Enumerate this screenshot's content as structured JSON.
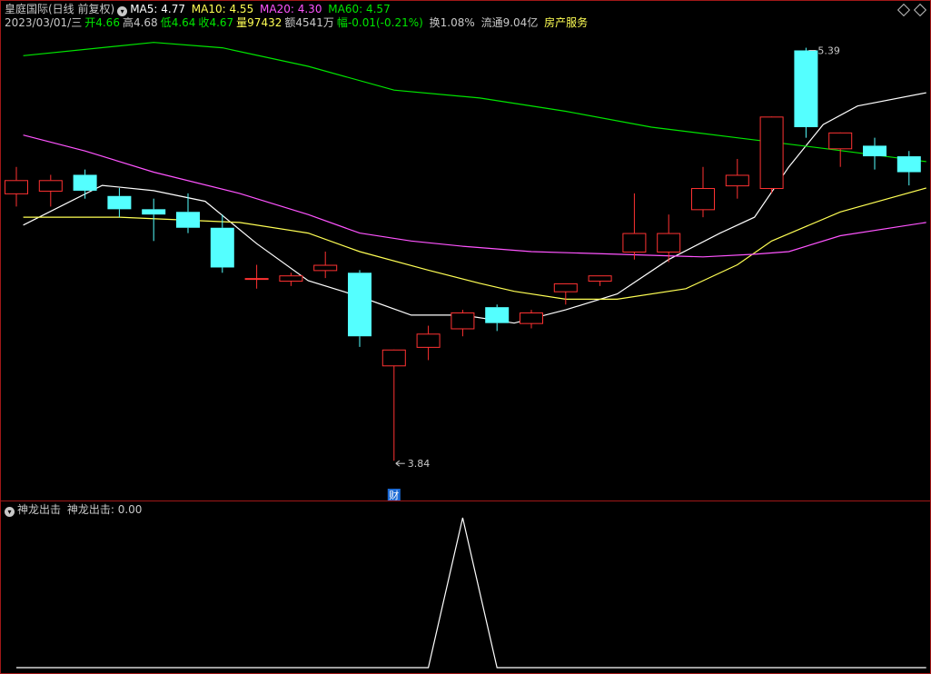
{
  "header": {
    "stock_title": "皇庭国际(日线 前复权)",
    "ma5_label": "MA5: 4.77",
    "ma10_label": "MA10: 4.55",
    "ma20_label": "MA20: 4.30",
    "ma60_label": "MA60: 4.57",
    "date": "2023/03/01/三",
    "open_label": "开",
    "open_value": "4.66",
    "high_label": "高",
    "high_value": "4.68",
    "low_label": "低",
    "low_value": "4.64",
    "close_label": "收",
    "close_value": "4.67",
    "volume_label": "量",
    "volume_value": "97432",
    "amount_label": "额",
    "amount_value": "4541万",
    "change_label": "幅",
    "change_value": "-0.01(-0.21%)",
    "turnover": "换1.08%",
    "float_cap": "流通9.04亿",
    "sector": "房产服务"
  },
  "indicator": {
    "name": "神龙出击",
    "value_label": "神龙出击: 0.00"
  },
  "colors": {
    "up": "#ff3232",
    "down": "#54ffff",
    "ma5": "#ffffff",
    "ma10": "#ffff54",
    "ma20": "#ff54ff",
    "ma60": "#00e600",
    "panel_border": "#a01818",
    "axis_text": "#c8c8c8"
  },
  "chart_data": [
    {
      "type": "candlestick",
      "y_range": [
        3.7,
        5.45
      ],
      "candles": [
        {
          "open": 4.85,
          "high": 4.95,
          "low": 4.8,
          "close": 4.9
        },
        {
          "open": 4.86,
          "high": 4.92,
          "low": 4.8,
          "close": 4.9
        },
        {
          "open": 4.92,
          "high": 4.94,
          "low": 4.83,
          "close": 4.86
        },
        {
          "open": 4.84,
          "high": 4.87,
          "low": 4.76,
          "close": 4.79
        },
        {
          "open": 4.79,
          "high": 4.83,
          "low": 4.67,
          "close": 4.77
        },
        {
          "open": 4.78,
          "high": 4.85,
          "low": 4.7,
          "close": 4.72
        },
        {
          "open": 4.72,
          "high": 4.77,
          "low": 4.55,
          "close": 4.57
        },
        {
          "open": 4.53,
          "high": 4.58,
          "low": 4.49,
          "close": 4.53
        },
        {
          "open": 4.52,
          "high": 4.55,
          "low": 4.5,
          "close": 4.54
        },
        {
          "open": 4.56,
          "high": 4.63,
          "low": 4.53,
          "close": 4.58
        },
        {
          "open": 4.55,
          "high": 4.56,
          "low": 4.27,
          "close": 4.31
        },
        {
          "open": 4.2,
          "high": 4.25,
          "low": 3.84,
          "close": 4.26
        },
        {
          "open": 4.27,
          "high": 4.35,
          "low": 4.22,
          "close": 4.32
        },
        {
          "open": 4.34,
          "high": 4.41,
          "low": 4.31,
          "close": 4.4
        },
        {
          "open": 4.42,
          "high": 4.43,
          "low": 4.33,
          "close": 4.36
        },
        {
          "open": 4.36,
          "high": 4.41,
          "low": 4.34,
          "close": 4.4
        },
        {
          "open": 4.48,
          "high": 4.51,
          "low": 4.43,
          "close": 4.51
        },
        {
          "open": 4.52,
          "high": 4.54,
          "low": 4.5,
          "close": 4.54
        },
        {
          "open": 4.63,
          "high": 4.85,
          "low": 4.6,
          "close": 4.7
        },
        {
          "open": 4.63,
          "high": 4.77,
          "low": 4.59,
          "close": 4.7
        },
        {
          "open": 4.79,
          "high": 4.95,
          "low": 4.76,
          "close": 4.87
        },
        {
          "open": 4.88,
          "high": 4.98,
          "low": 4.83,
          "close": 4.92
        },
        {
          "open": 4.87,
          "high": 5.03,
          "low": 4.85,
          "close": 5.14
        },
        {
          "open": 5.39,
          "high": 5.4,
          "low": 5.06,
          "close": 5.1
        },
        {
          "open": 5.02,
          "high": 5.05,
          "low": 4.95,
          "close": 5.08
        },
        {
          "open": 5.03,
          "high": 5.06,
          "low": 4.94,
          "close": 4.99
        },
        {
          "open": 4.99,
          "high": 5.01,
          "low": 4.88,
          "close": 4.93
        }
      ],
      "annotations": [
        {
          "text": "5.39",
          "candle": 23,
          "price": 5.39
        },
        {
          "text": "3.84",
          "candle": 11,
          "price": 3.84
        },
        {
          "text": "财",
          "candle": 11,
          "price": 3.81
        }
      ],
      "series": [
        {
          "name": "MA5",
          "color": "#ffffff",
          "points": [
            [
              0.2,
              4.73
            ],
            [
              2.5,
              4.88
            ],
            [
              4.0,
              4.86
            ],
            [
              5.5,
              4.82
            ],
            [
              7.0,
              4.66
            ],
            [
              8.5,
              4.52
            ],
            [
              10.0,
              4.46
            ],
            [
              11.5,
              4.39
            ],
            [
              13.0,
              4.39
            ],
            [
              14.5,
              4.36
            ],
            [
              16.0,
              4.41
            ],
            [
              17.5,
              4.47
            ],
            [
              19.0,
              4.6
            ],
            [
              20.5,
              4.7
            ],
            [
              21.5,
              4.76
            ],
            [
              22.5,
              4.95
            ],
            [
              23.5,
              5.11
            ],
            [
              24.5,
              5.18
            ],
            [
              26.5,
              5.23
            ]
          ]
        },
        {
          "name": "MA10",
          "color": "#ffff54",
          "points": [
            [
              0.2,
              4.76
            ],
            [
              3.0,
              4.76
            ],
            [
              6.5,
              4.74
            ],
            [
              8.5,
              4.7
            ],
            [
              10.0,
              4.63
            ],
            [
              12.0,
              4.56
            ],
            [
              13.5,
              4.51
            ],
            [
              14.5,
              4.48
            ],
            [
              16.0,
              4.45
            ],
            [
              17.5,
              4.45
            ],
            [
              19.5,
              4.49
            ],
            [
              21.0,
              4.58
            ],
            [
              22.0,
              4.67
            ],
            [
              24.0,
              4.78
            ],
            [
              26.5,
              4.87
            ]
          ]
        },
        {
          "name": "MA20",
          "color": "#ff54ff",
          "points": [
            [
              0.2,
              5.07
            ],
            [
              2.0,
              5.01
            ],
            [
              4.0,
              4.93
            ],
            [
              6.5,
              4.85
            ],
            [
              8.5,
              4.77
            ],
            [
              10.0,
              4.7
            ],
            [
              11.5,
              4.67
            ],
            [
              13.0,
              4.65
            ],
            [
              15.0,
              4.63
            ],
            [
              17.5,
              4.62
            ],
            [
              20.0,
              4.61
            ],
            [
              21.5,
              4.62
            ],
            [
              22.5,
              4.63
            ],
            [
              24.0,
              4.69
            ],
            [
              26.5,
              4.74
            ]
          ]
        },
        {
          "name": "MA60",
          "color": "#00e600",
          "points": [
            [
              0.2,
              5.37
            ],
            [
              4.0,
              5.42
            ],
            [
              6.0,
              5.4
            ],
            [
              8.5,
              5.33
            ],
            [
              11.0,
              5.24
            ],
            [
              13.5,
              5.21
            ],
            [
              16.0,
              5.16
            ],
            [
              18.5,
              5.1
            ],
            [
              21.0,
              5.06
            ],
            [
              23.5,
              5.02
            ],
            [
              26.5,
              4.97
            ]
          ]
        }
      ]
    },
    {
      "type": "line",
      "y_range": [
        0,
        1
      ],
      "series": [
        {
          "name": "神龙出击",
          "color": "#ffffff",
          "points": [
            [
              0,
              0
            ],
            [
              12.0,
              0
            ],
            [
              13.0,
              1
            ],
            [
              14.0,
              0
            ],
            [
              26.5,
              0
            ]
          ]
        }
      ]
    }
  ]
}
